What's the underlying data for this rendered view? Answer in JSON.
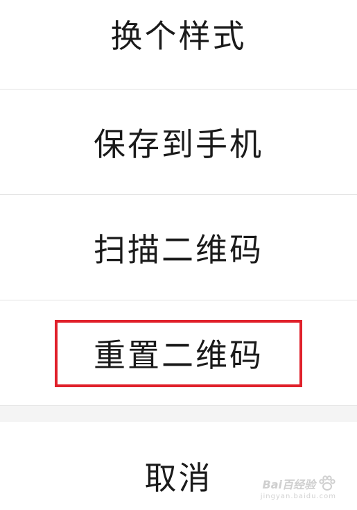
{
  "action_sheet": {
    "items": [
      {
        "label": "换个样式"
      },
      {
        "label": "保存到手机"
      },
      {
        "label": "扫描二维码"
      },
      {
        "label": "重置二维码"
      }
    ],
    "cancel_label": "取消",
    "highlight_color": "#e0202a"
  },
  "watermark": {
    "brand": "Bai百经验",
    "url": "jingyan.baidu.com"
  }
}
